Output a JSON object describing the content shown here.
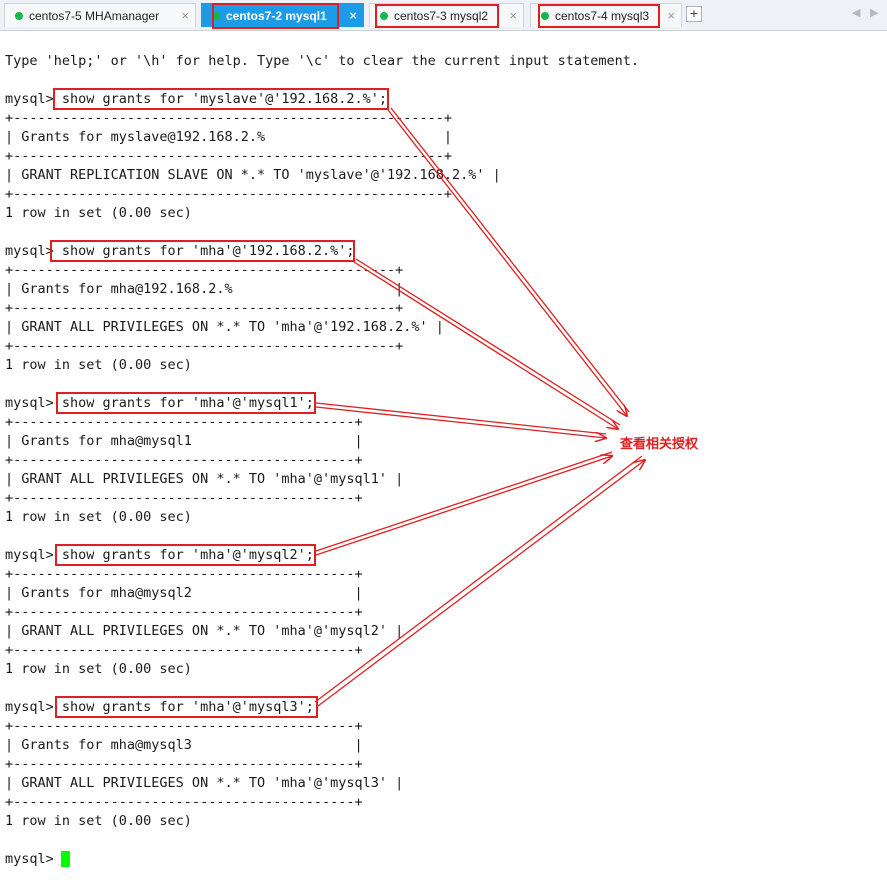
{
  "tabs": [
    {
      "label": "centos7-5 MHAmanager",
      "active": false,
      "highlighted": false
    },
    {
      "label": "centos7-2 mysql1",
      "active": true,
      "highlighted": true
    },
    {
      "label": "centos7-3 mysql2",
      "active": false,
      "highlighted": true
    },
    {
      "label": "centos7-4 mysql3",
      "active": false,
      "highlighted": true
    }
  ],
  "tab_close_glyph": "×",
  "tab_add_glyph": "+",
  "nav": {
    "prev": "◀",
    "next": "▶"
  },
  "terminal": {
    "lines": [
      "Type 'help;' or '\\h' for help. Type '\\c' to clear the current input statement.",
      "mysql> show grants for 'myslave'@'192.168.2.%';",
      "+-----------------------------------------------------+",
      "| Grants for myslave@192.168.2.%                      |",
      "+-----------------------------------------------------+",
      "| GRANT REPLICATION SLAVE ON *.* TO 'myslave'@'192.168.2.%' |",
      "+-----------------------------------------------------+",
      "1 row in set (0.00 sec)",
      "mysql> show grants for 'mha'@'192.168.2.%';",
      "+-----------------------------------------------+",
      "| Grants for mha@192.168.2.%                    |",
      "+-----------------------------------------------+",
      "| GRANT ALL PRIVILEGES ON *.* TO 'mha'@'192.168.2.%' |",
      "+-----------------------------------------------+",
      "1 row in set (0.00 sec)",
      "mysql> show grants for 'mha'@'mysql1';",
      "+------------------------------------------+",
      "| Grants for mha@mysql1                    |",
      "+------------------------------------------+",
      "| GRANT ALL PRIVILEGES ON *.* TO 'mha'@'mysql1' |",
      "+------------------------------------------+",
      "1 row in set (0.00 sec)",
      "mysql> show grants for 'mha'@'mysql2';",
      "+------------------------------------------+",
      "| Grants for mha@mysql2                    |",
      "+------------------------------------------+",
      "| GRANT ALL PRIVILEGES ON *.* TO 'mha'@'mysql2' |",
      "+------------------------------------------+",
      "1 row in set (0.00 sec)",
      "mysql> show grants for 'mha'@'mysql3';",
      "+------------------------------------------+",
      "| Grants for mha@mysql3                    |",
      "+------------------------------------------+",
      "| GRANT ALL PRIVILEGES ON *.* TO 'mha'@'mysql3' |",
      "+------------------------------------------+",
      "1 row in set (0.00 sec)",
      "mysql> "
    ]
  },
  "annotation": {
    "text": "查看相关授权",
    "color": "#e02020"
  },
  "colors": {
    "accent": "#1e9be6",
    "highlight": "#e02020",
    "cursor": "#00ff00",
    "status_dot": "#15b84a"
  }
}
